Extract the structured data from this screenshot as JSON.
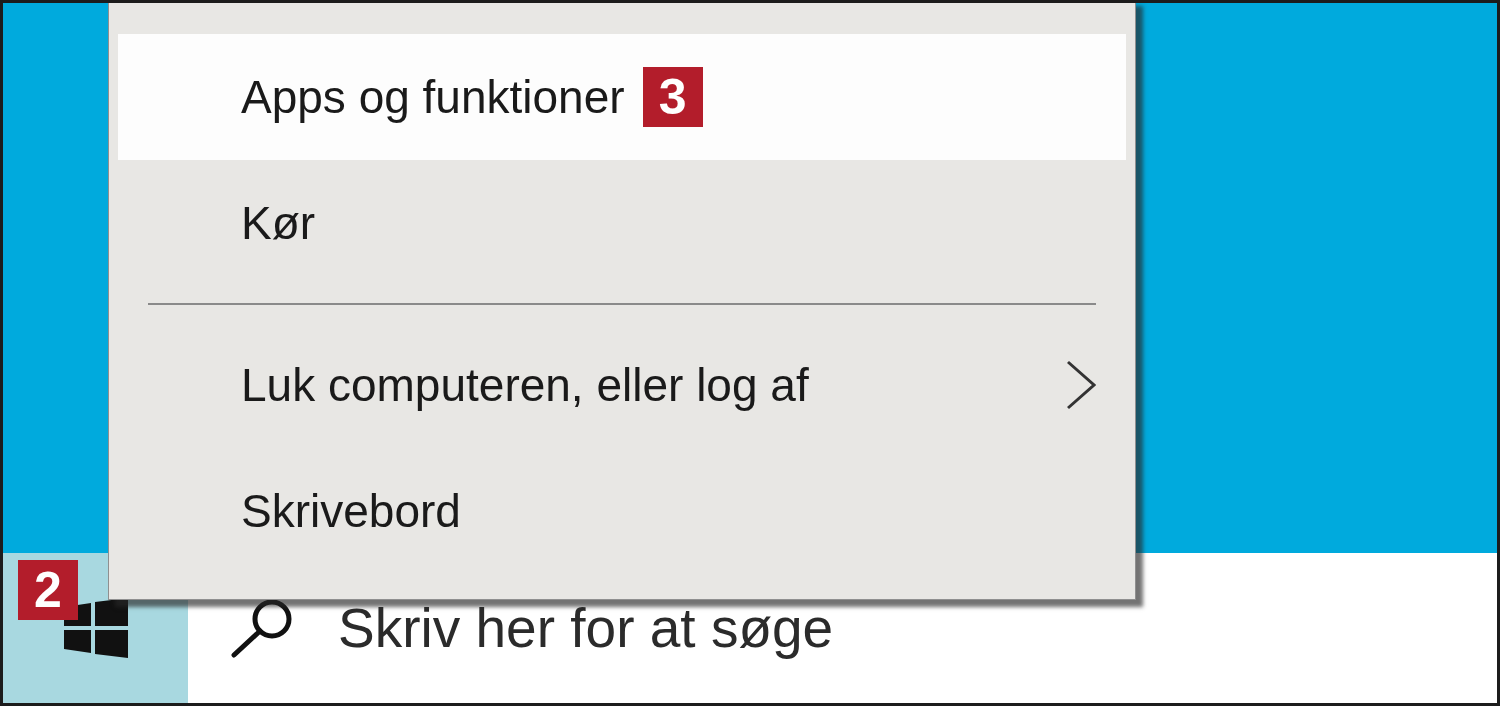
{
  "context_menu": {
    "items": [
      {
        "kind": "item",
        "label": "Apps og funktioner",
        "selected": true,
        "submenu": false,
        "callout": "3"
      },
      {
        "kind": "item",
        "label": "Kør",
        "selected": false,
        "submenu": false
      },
      {
        "kind": "separator"
      },
      {
        "kind": "item",
        "label": "Luk computeren, eller log af",
        "selected": false,
        "submenu": true
      },
      {
        "kind": "item",
        "label": "Skrivebord",
        "selected": false,
        "submenu": false
      }
    ]
  },
  "taskbar": {
    "start_button": {
      "active": true,
      "callout": "2"
    },
    "search": {
      "placeholder": "Skriv her for at søge"
    }
  }
}
